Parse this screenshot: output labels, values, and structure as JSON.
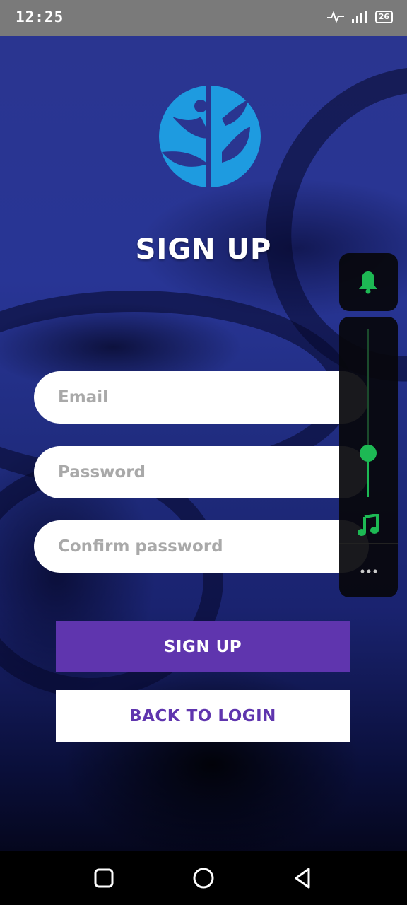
{
  "status_bar": {
    "time": "12:25",
    "battery": "26",
    "icons": [
      "activity-icon",
      "signal-icon",
      "battery-icon"
    ]
  },
  "logo": {
    "name": "leaf-person-logo",
    "color": "#1e9be0"
  },
  "screen": {
    "title": "SIGN UP"
  },
  "form": {
    "email_placeholder": "Email",
    "email_value": "",
    "password_placeholder": "Password",
    "password_value": "",
    "confirm_placeholder": "Confirm password",
    "confirm_value": ""
  },
  "buttons": {
    "signup_label": "SIGN UP",
    "back_label": "BACK TO LOGIN"
  },
  "volume_panel": {
    "bell": "bell-icon",
    "music": "music-note-icon",
    "more": "more-icon",
    "level": 0.35,
    "accent": "#1db954"
  },
  "colors": {
    "primary": "#5f35ae",
    "background": "#283595",
    "status_bar": "#7a7a7a"
  },
  "nav_bar": {
    "icons": [
      "recents-icon",
      "home-icon",
      "back-icon"
    ]
  }
}
